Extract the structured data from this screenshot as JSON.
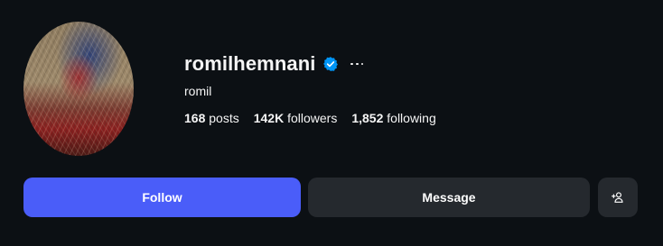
{
  "profile": {
    "username": "romilhemnani",
    "full_name": "romil",
    "verified": true,
    "avatar_icon": "profile-photo-icon"
  },
  "stats": {
    "posts_count": "168",
    "posts_label": "posts",
    "followers_count": "142K",
    "followers_label": "followers",
    "following_count": "1,852",
    "following_label": "following"
  },
  "actions": {
    "follow_label": "Follow",
    "message_label": "Message",
    "suggest_icon": "add-person-icon",
    "more_icon": "more-options-icon"
  },
  "colors": {
    "background": "#0c1014",
    "follow_button": "#4a5df9",
    "secondary_button": "#25292e",
    "verified_badge": "#0095f6"
  }
}
